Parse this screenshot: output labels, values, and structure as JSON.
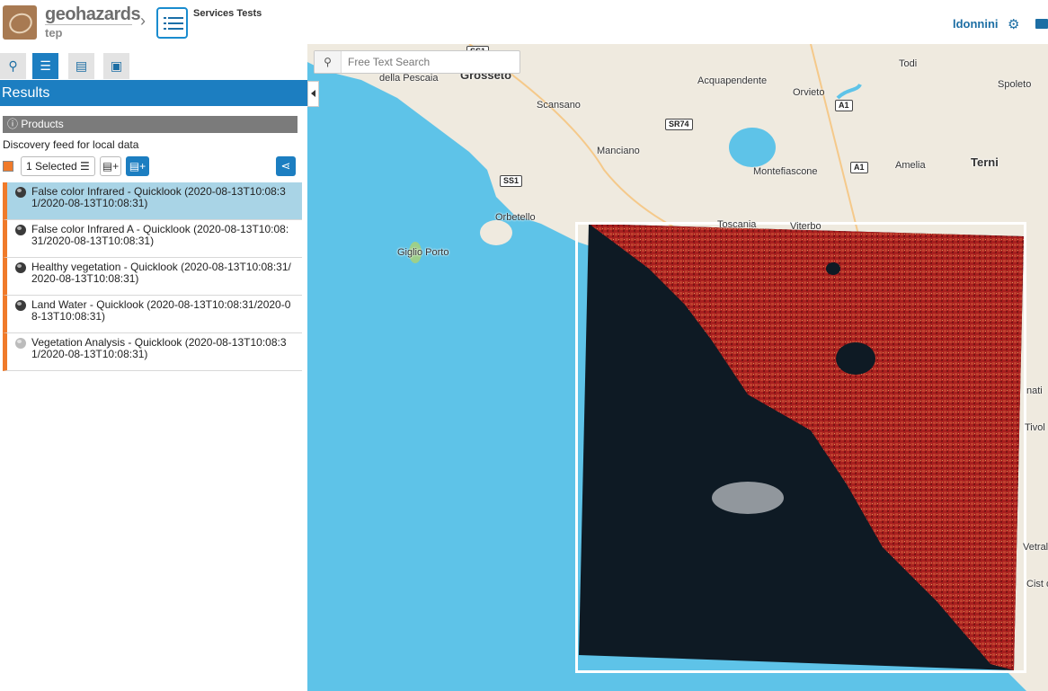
{
  "header": {
    "brand": "geohazards",
    "brand_sub": "tep",
    "app_title": "Services Tests",
    "user": "ldonnini"
  },
  "icons": {
    "logo": "geohazards-logo",
    "app": "services-tests-icon",
    "settings": "gear-icon",
    "mail": "mail-icon"
  },
  "sidebar": {
    "tabs": [
      {
        "name": "search",
        "icon": "search-icon",
        "glyph": "🔍"
      },
      {
        "name": "results",
        "icon": "list-icon",
        "glyph": "☰"
      },
      {
        "name": "basket",
        "icon": "basket-icon",
        "glyph": "🧺"
      },
      {
        "name": "archive",
        "icon": "archive-icon",
        "glyph": "▣"
      }
    ],
    "results_title": "Results",
    "products_label": "Products",
    "feed_description": "Discovery feed for local data",
    "selected_label": "1 Selected ☰",
    "basket_add_glyph": "🧺+",
    "share_glyph": "⋖",
    "results": [
      {
        "title": "False color Infrared - Quicklook (2020-08-13T10:08:3",
        "title2": "1/2020-08-13T10:08:31)",
        "active": true
      },
      {
        "title": "False color Infrared A - Quicklook (2020-08-13T10:08:",
        "title2": "31/2020-08-13T10:08:31)",
        "active": false
      },
      {
        "title": "Healthy vegetation - Quicklook (2020-08-13T10:08:31/",
        "title2": "2020-08-13T10:08:31)",
        "active": false
      },
      {
        "title": "Land Water - Quicklook (2020-08-13T10:08:31/2020-0",
        "title2": "8-13T10:08:31)",
        "active": false
      },
      {
        "title": "Vegetation Analysis - Quicklook (2020-08-13T10:08:3",
        "title2": "1/2020-08-13T10:08:31)",
        "active": false
      }
    ]
  },
  "map": {
    "search_placeholder": "Free Text Search",
    "places": [
      "Grosseto",
      "della Pescaia",
      "Scansano",
      "Acquapendente",
      "Orvieto",
      "Todi",
      "Spoleto",
      "Manciano",
      "Montefiascone",
      "Amelia",
      "Terni",
      "Orbetello",
      "Giglio Porto",
      "Viterbo",
      "Toscania",
      "Vetral",
      "Cist di La",
      "Tivol",
      "nati"
    ],
    "roads": [
      "SS1",
      "SR74",
      "A1",
      "A1",
      "SS1"
    ],
    "colors": {
      "sea": "#5ec3e8",
      "land": "#efeadf",
      "quicklook_sea": "#0e1a24",
      "quicklook_land": "#a81f1f"
    }
  }
}
